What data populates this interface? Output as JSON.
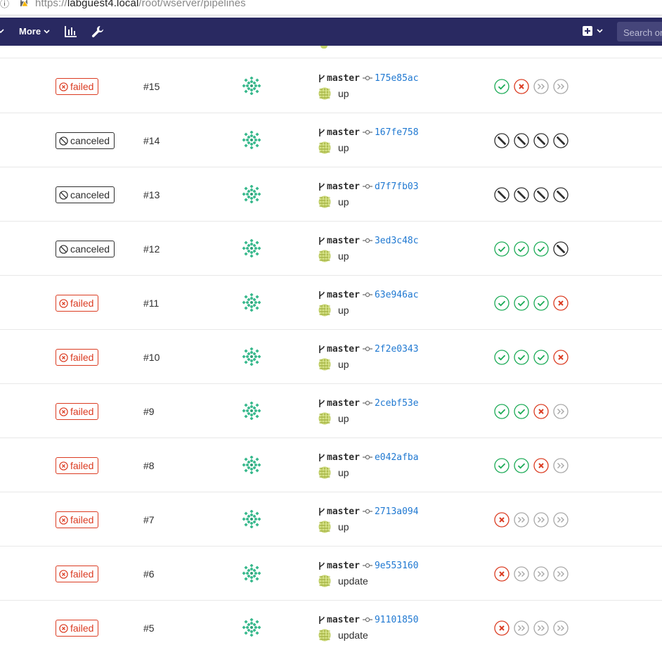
{
  "browser": {
    "url_scheme": "https://",
    "url_host": "labguest4.local",
    "url_path": "/root/wserver/pipelines"
  },
  "nav": {
    "more_label": "More",
    "search_placeholder": "Search or jump to…",
    "color": "#292961"
  },
  "colors": {
    "failed": "#db3b21",
    "canceled": "#2e2e2e",
    "success": "#1aaa55",
    "skipped": "#a7a7a7",
    "link": "#1f78d1"
  },
  "pipelines": [
    {
      "status": "failed",
      "id": "#15",
      "branch": "master",
      "sha": "175e85ac",
      "message": "up",
      "stages": [
        "success",
        "failed",
        "skipped",
        "skipped"
      ]
    },
    {
      "status": "canceled",
      "id": "#14",
      "branch": "master",
      "sha": "167fe758",
      "message": "up",
      "stages": [
        "canceled",
        "canceled",
        "canceled",
        "canceled"
      ]
    },
    {
      "status": "canceled",
      "id": "#13",
      "branch": "master",
      "sha": "d7f7fb03",
      "message": "up",
      "stages": [
        "canceled",
        "canceled",
        "canceled",
        "canceled"
      ]
    },
    {
      "status": "canceled",
      "id": "#12",
      "branch": "master",
      "sha": "3ed3c48c",
      "message": "up",
      "stages": [
        "success",
        "success",
        "success",
        "canceled"
      ]
    },
    {
      "status": "failed",
      "id": "#11",
      "branch": "master",
      "sha": "63e946ac",
      "message": "up",
      "stages": [
        "success",
        "success",
        "success",
        "failed"
      ]
    },
    {
      "status": "failed",
      "id": "#10",
      "branch": "master",
      "sha": "2f2e0343",
      "message": "up",
      "stages": [
        "success",
        "success",
        "success",
        "failed"
      ]
    },
    {
      "status": "failed",
      "id": "#9",
      "branch": "master",
      "sha": "2cebf53e",
      "message": "up",
      "stages": [
        "success",
        "success",
        "failed",
        "skipped"
      ]
    },
    {
      "status": "failed",
      "id": "#8",
      "branch": "master",
      "sha": "e042afba",
      "message": "up",
      "stages": [
        "success",
        "success",
        "failed",
        "skipped"
      ]
    },
    {
      "status": "failed",
      "id": "#7",
      "branch": "master",
      "sha": "2713a094",
      "message": "up",
      "stages": [
        "failed",
        "skipped",
        "skipped",
        "skipped"
      ]
    },
    {
      "status": "failed",
      "id": "#6",
      "branch": "master",
      "sha": "9e553160",
      "message": "update",
      "stages": [
        "failed",
        "skipped",
        "skipped",
        "skipped"
      ]
    },
    {
      "status": "failed",
      "id": "#5",
      "branch": "master",
      "sha": "91101850",
      "message": "update",
      "stages": [
        "failed",
        "skipped",
        "skipped",
        "skipped"
      ]
    }
  ]
}
